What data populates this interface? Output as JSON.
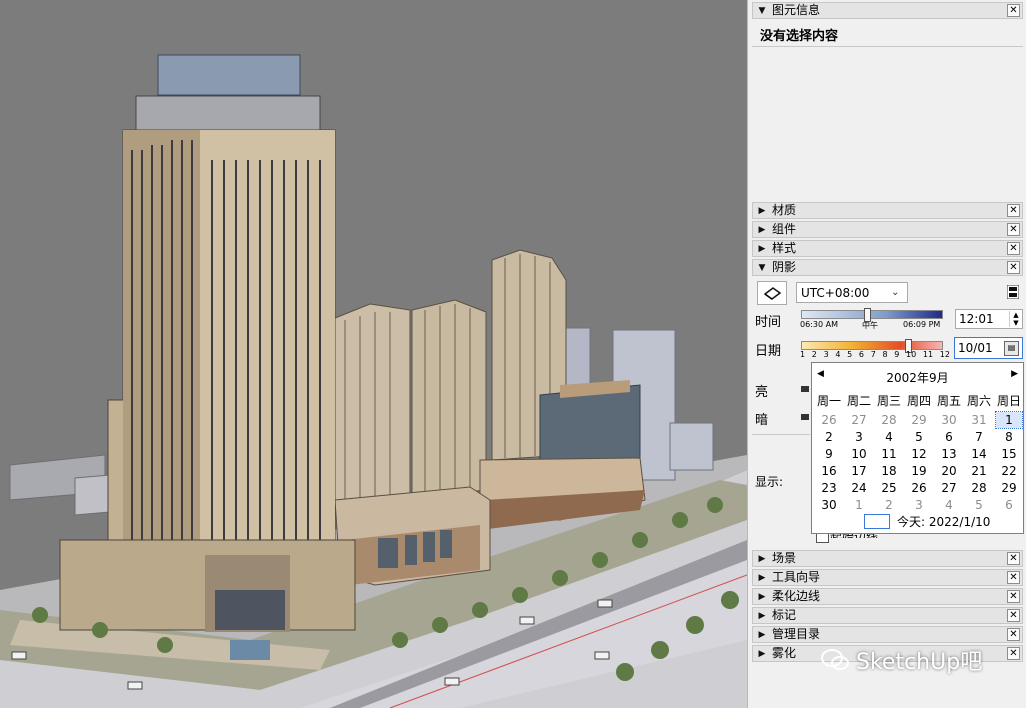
{
  "tray": {
    "entity_info": {
      "title": "图元信息",
      "content": "没有选择内容"
    },
    "panels_mid": [
      {
        "title": "材质"
      },
      {
        "title": "组件"
      },
      {
        "title": "样式"
      }
    ],
    "shadows": {
      "title": "阴影",
      "timezone": "UTC+08:00",
      "time_label": "时间",
      "time_start": "06:30 AM",
      "time_mid": "中午",
      "time_end": "06:09 PM",
      "time_value": "12:01",
      "date_label": "日期",
      "date_ticks": [
        "1",
        "2",
        "3",
        "4",
        "5",
        "6",
        "7",
        "8",
        "9",
        "10",
        "11",
        "12"
      ],
      "date_value": "10/01",
      "light_label": "亮",
      "dark_label": "暗",
      "display_label": "显示:",
      "edges_label": "起始边线"
    },
    "panels_bottom": [
      {
        "title": "场景"
      },
      {
        "title": "工具向导"
      },
      {
        "title": "柔化边线"
      },
      {
        "title": "标记"
      },
      {
        "title": "管理目录"
      },
      {
        "title": "雾化"
      }
    ]
  },
  "calendar": {
    "month_title": "2002年9月",
    "weekdays": [
      "周一",
      "周二",
      "周三",
      "周四",
      "周五",
      "周六",
      "周日"
    ],
    "weeks": [
      [
        "26",
        "27",
        "28",
        "29",
        "30",
        "31",
        "1"
      ],
      [
        "2",
        "3",
        "4",
        "5",
        "6",
        "7",
        "8"
      ],
      [
        "9",
        "10",
        "11",
        "12",
        "13",
        "14",
        "15"
      ],
      [
        "16",
        "17",
        "18",
        "19",
        "20",
        "21",
        "22"
      ],
      [
        "23",
        "24",
        "25",
        "26",
        "27",
        "28",
        "29"
      ],
      [
        "30",
        "1",
        "2",
        "3",
        "4",
        "5",
        "6"
      ]
    ],
    "today_label": "今天: 2022/1/10"
  },
  "watermark": {
    "text": "SketchUp吧"
  },
  "colors": {
    "accent": "#3b78d8",
    "tray_bg": "#f0f0f0",
    "sky": "#7c7c7c"
  }
}
